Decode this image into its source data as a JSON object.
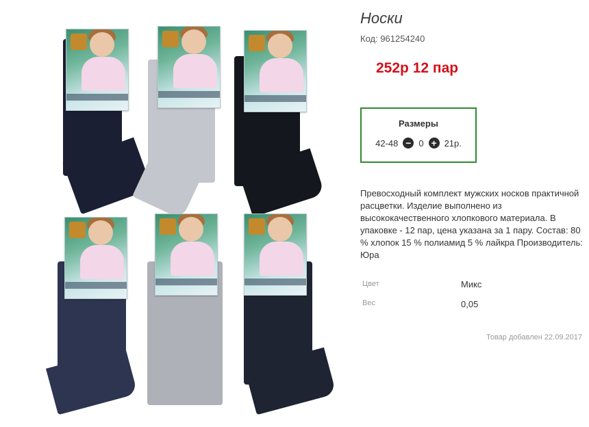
{
  "product": {
    "title": "Носки",
    "code_label": "Код: 961254240",
    "price": "252р 12 пар"
  },
  "sizes": {
    "title": "Размеры",
    "size": "42-48",
    "quantity": "0",
    "price": "21р."
  },
  "description": "Превосходный комплект мужских носков практичной расцветки. Изделие выполнено из высококачественного хлопкового материала. В упаковке - 12 пар, цена указана за 1 пару. Состав: 80 % хлопок 15 % полиамид 5 % лайкра Производитель: Юра",
  "attributes": [
    {
      "label": "Цвет",
      "value": "Микс"
    },
    {
      "label": "Вес",
      "value": "0,05"
    }
  ],
  "added": "Товар добавлен 22.09.2017",
  "colors": {
    "price": "#d0121b",
    "sizes_border": "#2f8a2f",
    "sock_colors": [
      "#1a1f33",
      "#c3c6cc",
      "#15171f",
      "#2d3550",
      "#aeb1b8",
      "#1f2433"
    ]
  }
}
